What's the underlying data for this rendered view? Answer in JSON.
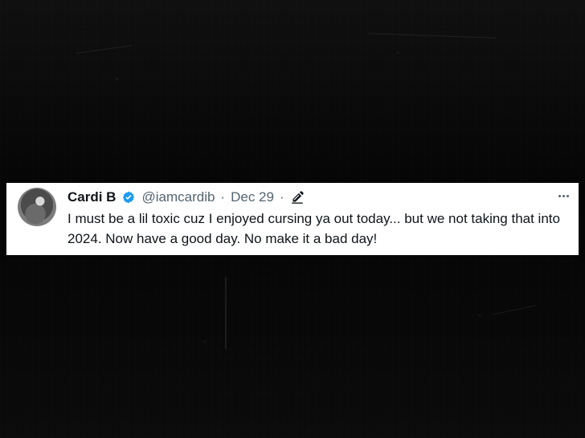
{
  "tweet": {
    "name": "Cardi B",
    "handle": "@iamcardib",
    "date": "Dec 29",
    "text": "I must be a lil toxic cuz I enjoyed cursing ya out today... but we not taking that into 2024. Now have a good day. No make it a bad day!",
    "icons": {
      "verified": "verified-badge-icon",
      "edited": "pencil-icon",
      "more": "more-options-icon"
    },
    "colors": {
      "verified": "#1d9bf0",
      "text": "#0f1419",
      "muted": "#536471"
    }
  }
}
